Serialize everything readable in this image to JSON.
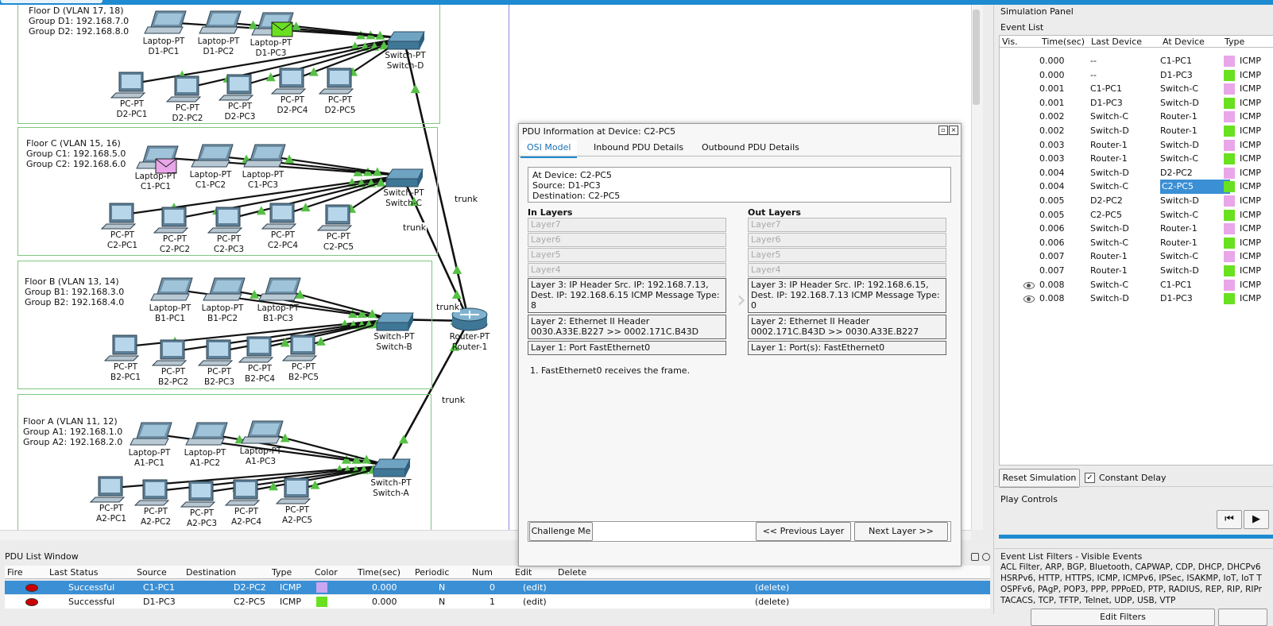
{
  "colors": {
    "accent": "#1e8bd1",
    "link_green": "#55c044",
    "pdu_pink": "#e9a6e9",
    "pdu_green": "#69e020",
    "selection": "#3b8fd4"
  },
  "workspace": {
    "floors": [
      {
        "name": "Floor D (VLAN 17, 18)",
        "g1": "Group D1: 192.168.7.0",
        "g2": "Group D2: 192.168.8.0"
      },
      {
        "name": "Floor C (VLAN 15, 16)",
        "g1": "Group C1: 192.168.5.0",
        "g2": "Group C2: 192.168.6.0"
      },
      {
        "name": "Floor B (VLAN 13, 14)",
        "g1": "Group B1: 192.168.3.0",
        "g2": "Group B2: 192.168.4.0"
      },
      {
        "name": "Floor A (VLAN 11, 12)",
        "g1": "Group A1: 192.168.1.0",
        "g2": "Group A2: 192.168.2.0"
      }
    ],
    "trunk_label": "trunk",
    "devices": [
      {
        "type": "Laptop-PT",
        "name": "D1-PC1"
      },
      {
        "type": "Laptop-PT",
        "name": "D1-PC2"
      },
      {
        "type": "Laptop-PT",
        "name": "D1-PC3"
      },
      {
        "type": "PC-PT",
        "name": "D2-PC1"
      },
      {
        "type": "PC-PT",
        "name": "D2-PC2"
      },
      {
        "type": "PC-PT",
        "name": "D2-PC3"
      },
      {
        "type": "PC-PT",
        "name": "D2-PC4"
      },
      {
        "type": "PC-PT",
        "name": "D2-PC5"
      },
      {
        "type": "Switch-PT",
        "name": "Switch-D"
      },
      {
        "type": "Laptop-PT",
        "name": "C1-PC1"
      },
      {
        "type": "Laptop-PT",
        "name": "C1-PC2"
      },
      {
        "type": "Laptop-PT",
        "name": "C1-PC3"
      },
      {
        "type": "PC-PT",
        "name": "C2-PC1"
      },
      {
        "type": "PC-PT",
        "name": "C2-PC2"
      },
      {
        "type": "PC-PT",
        "name": "C2-PC3"
      },
      {
        "type": "PC-PT",
        "name": "C2-PC4"
      },
      {
        "type": "PC-PT",
        "name": "C2-PC5"
      },
      {
        "type": "Switch-PT",
        "name": "Switch-C"
      },
      {
        "type": "Laptop-PT",
        "name": "B1-PC1"
      },
      {
        "type": "Laptop-PT",
        "name": "B1-PC2"
      },
      {
        "type": "Laptop-PT",
        "name": "B1-PC3"
      },
      {
        "type": "PC-PT",
        "name": "B2-PC1"
      },
      {
        "type": "PC-PT",
        "name": "B2-PC2"
      },
      {
        "type": "PC-PT",
        "name": "B2-PC3"
      },
      {
        "type": "PC-PT",
        "name": "B2-PC4"
      },
      {
        "type": "PC-PT",
        "name": "B2-PC5"
      },
      {
        "type": "Switch-PT",
        "name": "Switch-B"
      },
      {
        "type": "Router-PT",
        "name": "Router-1"
      },
      {
        "type": "Laptop-PT",
        "name": "A1-PC1"
      },
      {
        "type": "Laptop-PT",
        "name": "A1-PC2"
      },
      {
        "type": "Laptop-PT",
        "name": "A1-PC3"
      },
      {
        "type": "PC-PT",
        "name": "A2-PC1"
      },
      {
        "type": "PC-PT",
        "name": "A2-PC2"
      },
      {
        "type": "PC-PT",
        "name": "A2-PC3"
      },
      {
        "type": "PC-PT",
        "name": "A2-PC4"
      },
      {
        "type": "PC-PT",
        "name": "A2-PC5"
      },
      {
        "type": "Switch-PT",
        "name": "Switch-A"
      }
    ]
  },
  "pdu_list": {
    "title": "PDU List Window",
    "headers": [
      "Fire",
      "Last Status",
      "Source",
      "Destination",
      "Type",
      "Color",
      "Time(sec)",
      "Periodic",
      "Num",
      "Edit",
      "Delete"
    ],
    "rows": [
      {
        "status": "Successful",
        "source": "C1-PC1",
        "destination": "D2-PC2",
        "type": "ICMP",
        "color": "#c9a6f2",
        "time": "0.000",
        "periodic": "N",
        "num": "0",
        "edit": "(edit)",
        "delete": "(delete)"
      },
      {
        "status": "Successful",
        "source": "D1-PC3",
        "destination": "C2-PC5",
        "type": "ICMP",
        "color": "#69e020",
        "time": "0.000",
        "periodic": "N",
        "num": "1",
        "edit": "(edit)",
        "delete": "(delete)"
      }
    ]
  },
  "dialog": {
    "title": "PDU Information at Device: C2-PC5",
    "tabs": [
      "OSI Model",
      "Inbound PDU Details",
      "Outbound PDU Details"
    ],
    "info": {
      "device": "At Device: C2-PC5",
      "source": "Source: D1-PC3",
      "destination": "Destination: C2-PC5"
    },
    "in_layers_title": "In Layers",
    "out_layers_title": "Out Layers",
    "layer7": "Layer7",
    "layer6": "Layer6",
    "layer5": "Layer5",
    "layer4": "Layer4",
    "in_l3": "Layer 3: IP Header Src. IP: 192.168.7.13, Dest. IP: 192.168.6.15 ICMP Message Type: 8",
    "in_l2": "Layer 2: Ethernet II Header 0030.A33E.B227 >> 0002.171C.B43D",
    "in_l1": "Layer 1: Port FastEthernet0",
    "out_l3": "Layer 3: IP Header Src. IP: 192.168.6.15, Dest. IP: 192.168.7.13 ICMP Message Type: 0",
    "out_l2": "Layer 2: Ethernet II Header 0002.171C.B43D >> 0030.A33E.B227",
    "out_l1": "Layer 1: Port(s): FastEthernet0",
    "note": "1. FastEthernet0 receives the frame.",
    "challenge": "Challenge Me",
    "prev": "<< Previous Layer",
    "next": "Next Layer >>"
  },
  "sim": {
    "title": "Simulation Panel",
    "event_list_title": "Event List",
    "headers": [
      "Vis.",
      "Time(sec)",
      "Last Device",
      "At Device",
      "Type"
    ],
    "events": [
      {
        "vis": "",
        "time": "0.000",
        "last": "--",
        "at": "C1-PC1",
        "color": "#e9a6e9",
        "type": "ICMP"
      },
      {
        "vis": "",
        "time": "0.000",
        "last": "--",
        "at": "D1-PC3",
        "color": "#69e020",
        "type": "ICMP"
      },
      {
        "vis": "",
        "time": "0.001",
        "last": "C1-PC1",
        "at": "Switch-C",
        "color": "#e9a6e9",
        "type": "ICMP"
      },
      {
        "vis": "",
        "time": "0.001",
        "last": "D1-PC3",
        "at": "Switch-D",
        "color": "#69e020",
        "type": "ICMP"
      },
      {
        "vis": "",
        "time": "0.002",
        "last": "Switch-C",
        "at": "Router-1",
        "color": "#e9a6e9",
        "type": "ICMP"
      },
      {
        "vis": "",
        "time": "0.002",
        "last": "Switch-D",
        "at": "Router-1",
        "color": "#69e020",
        "type": "ICMP"
      },
      {
        "vis": "",
        "time": "0.003",
        "last": "Router-1",
        "at": "Switch-D",
        "color": "#e9a6e9",
        "type": "ICMP"
      },
      {
        "vis": "",
        "time": "0.003",
        "last": "Router-1",
        "at": "Switch-C",
        "color": "#69e020",
        "type": "ICMP"
      },
      {
        "vis": "",
        "time": "0.004",
        "last": "Switch-D",
        "at": "D2-PC2",
        "color": "#e9a6e9",
        "type": "ICMP"
      },
      {
        "vis": "",
        "time": "0.004",
        "last": "Switch-C",
        "at": "C2-PC5",
        "color": "#69e020",
        "type": "ICMP",
        "selected": true
      },
      {
        "vis": "",
        "time": "0.005",
        "last": "D2-PC2",
        "at": "Switch-D",
        "color": "#e9a6e9",
        "type": "ICMP"
      },
      {
        "vis": "",
        "time": "0.005",
        "last": "C2-PC5",
        "at": "Switch-C",
        "color": "#69e020",
        "type": "ICMP"
      },
      {
        "vis": "",
        "time": "0.006",
        "last": "Switch-D",
        "at": "Router-1",
        "color": "#e9a6e9",
        "type": "ICMP"
      },
      {
        "vis": "",
        "time": "0.006",
        "last": "Switch-C",
        "at": "Router-1",
        "color": "#69e020",
        "type": "ICMP"
      },
      {
        "vis": "",
        "time": "0.007",
        "last": "Router-1",
        "at": "Switch-C",
        "color": "#e9a6e9",
        "type": "ICMP"
      },
      {
        "vis": "",
        "time": "0.007",
        "last": "Router-1",
        "at": "Switch-D",
        "color": "#69e020",
        "type": "ICMP"
      },
      {
        "vis": "eye-icon",
        "time": "0.008",
        "last": "Switch-C",
        "at": "C1-PC1",
        "color": "#e9a6e9",
        "type": "ICMP"
      },
      {
        "vis": "eye-icon",
        "time": "0.008",
        "last": "Switch-D",
        "at": "D1-PC3",
        "color": "#69e020",
        "type": "ICMP"
      }
    ],
    "reset": "Reset Simulation",
    "constant_delay": "Constant Delay",
    "constant_delay_checked": true,
    "play_controls_title": "Play Controls",
    "filters_title": "Event List Filters - Visible Events",
    "filters": [
      "ACL Filter, ARP, BGP, Bluetooth, CAPWAP, CDP, DHCP, DHCPv6",
      "HSRPv6, HTTP, HTTPS, ICMP, ICMPv6, IPSec, ISAKMP, IoT, IoT T",
      "OSPFv6, PAgP, POP3, PPP, PPPoED, PTP, RADIUS, REP, RIP, RIPr",
      "TACACS, TCP, TFTP, Telnet, UDP, USB, VTP"
    ],
    "edit_filters": "Edit Filters"
  }
}
